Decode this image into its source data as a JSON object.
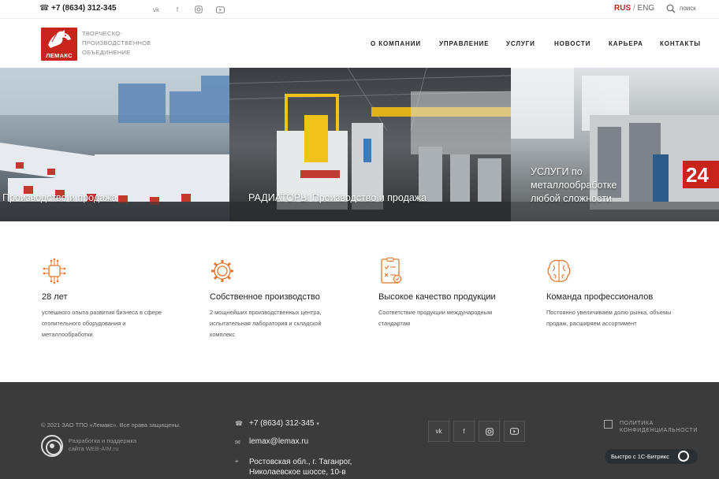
{
  "topbar": {
    "phone": "+7 (8634) 312-345",
    "social_icons": [
      "vk-icon",
      "facebook-icon",
      "instagram-icon",
      "youtube-icon"
    ],
    "lang_active": "RUS",
    "lang_sep": "/",
    "lang_other": "ENG",
    "search_label": "поиск"
  },
  "header": {
    "logo_text": "ЛЕМАКС",
    "company_desc": [
      "ТВОРЧЕСКО-",
      "ПРОИЗВОДСТВЕННОЕ",
      "ОБЪЕДИНЕНИЕ"
    ],
    "nav": [
      "О КОМПАНИИ",
      "УПРАВЛЕНИЕ",
      "УСЛУГИ",
      "НОВОСТИ",
      "КАРЬЕРА",
      "КОНТАКТЫ"
    ]
  },
  "hero": {
    "panels": [
      {
        "caption": "Производство и продажа"
      },
      {
        "caption": "РАДИАТОРЫ Производство и продажа"
      },
      {
        "caption_lines": [
          "УСЛУГИ по",
          "металлообработке",
          "любой сложности"
        ]
      }
    ]
  },
  "features": [
    {
      "icon": "circuit-chip-icon",
      "title": "28 лет",
      "desc": [
        "успешного опыта развития бизнеса в сфере",
        "отопительного оборудования и",
        "металлообработки"
      ]
    },
    {
      "icon": "gear-icon",
      "title": "Собственное производство",
      "desc": [
        "2 мощнейших производственных центра,",
        "испытательная лаборатория и складской",
        "комплекс"
      ]
    },
    {
      "icon": "checklist-icon",
      "title": "Высокое качество продукции",
      "desc": [
        "Соответствие продукции международным",
        "стандартам"
      ]
    },
    {
      "icon": "brain-icon",
      "title": "Команда профессионалов",
      "desc": [
        "Постоянно увеличиваем долю рынка, объемы",
        "продаж, расширяем ассортимент"
      ]
    }
  ],
  "footer": {
    "copyright": "© 2021 ЗАО ТПО «Лемакс». Все права защищены.",
    "developer_line1": "Разработка и поддержка",
    "developer_prefix": "сайта ",
    "developer_link": "WEB-AIM.ru",
    "phone": "+7 (8634) 312-345",
    "email": "lemax@lemax.ru",
    "address_line1": "Ростовская обл., г. Таганрог,",
    "address_line2": "Николаевское шоссе, 10-в",
    "social_icons": [
      "vk-icon",
      "facebook-icon",
      "instagram-icon",
      "youtube-icon"
    ],
    "policy_line1": "ПОЛИТИКА",
    "policy_line2": "КОНФИДЕНЦИАЛЬНОСТИ",
    "bitrix_label": "Быстро с 1С-Битрикс"
  },
  "colors": {
    "brand": "#c8241c",
    "accent": "#e2782f",
    "footer_bg": "#3b3b3b"
  }
}
